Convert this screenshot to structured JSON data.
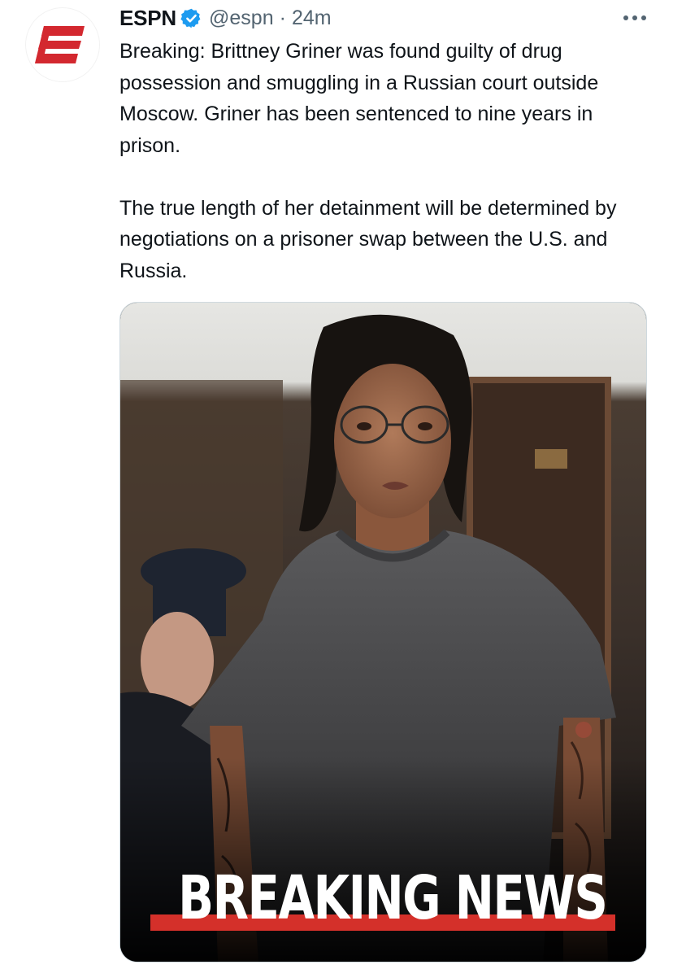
{
  "account": {
    "display_name": "ESPN",
    "handle": "@espn",
    "separator": "·",
    "time": "24m",
    "verified": true,
    "avatar_icon": "espn-e-logo",
    "avatar_color": "#d3282f"
  },
  "tweet": {
    "paragraphs": [
      "Breaking: Brittney Griner was found guilty of drug possession and smuggling in a Russian court outside Moscow. Griner has been sentenced to nine years in prison.",
      "The true length of her detainment will be determined by negotiations on a prisoner swap between the U.S. and Russia."
    ]
  },
  "media": {
    "overlay_text": "BREAKING NEWS",
    "accent_color": "#d4302a"
  },
  "icons": {
    "verified": "verified-badge-icon",
    "more": "more-options-icon"
  },
  "colors": {
    "verified_blue": "#1d9bf0",
    "secondary_text": "#536471"
  }
}
